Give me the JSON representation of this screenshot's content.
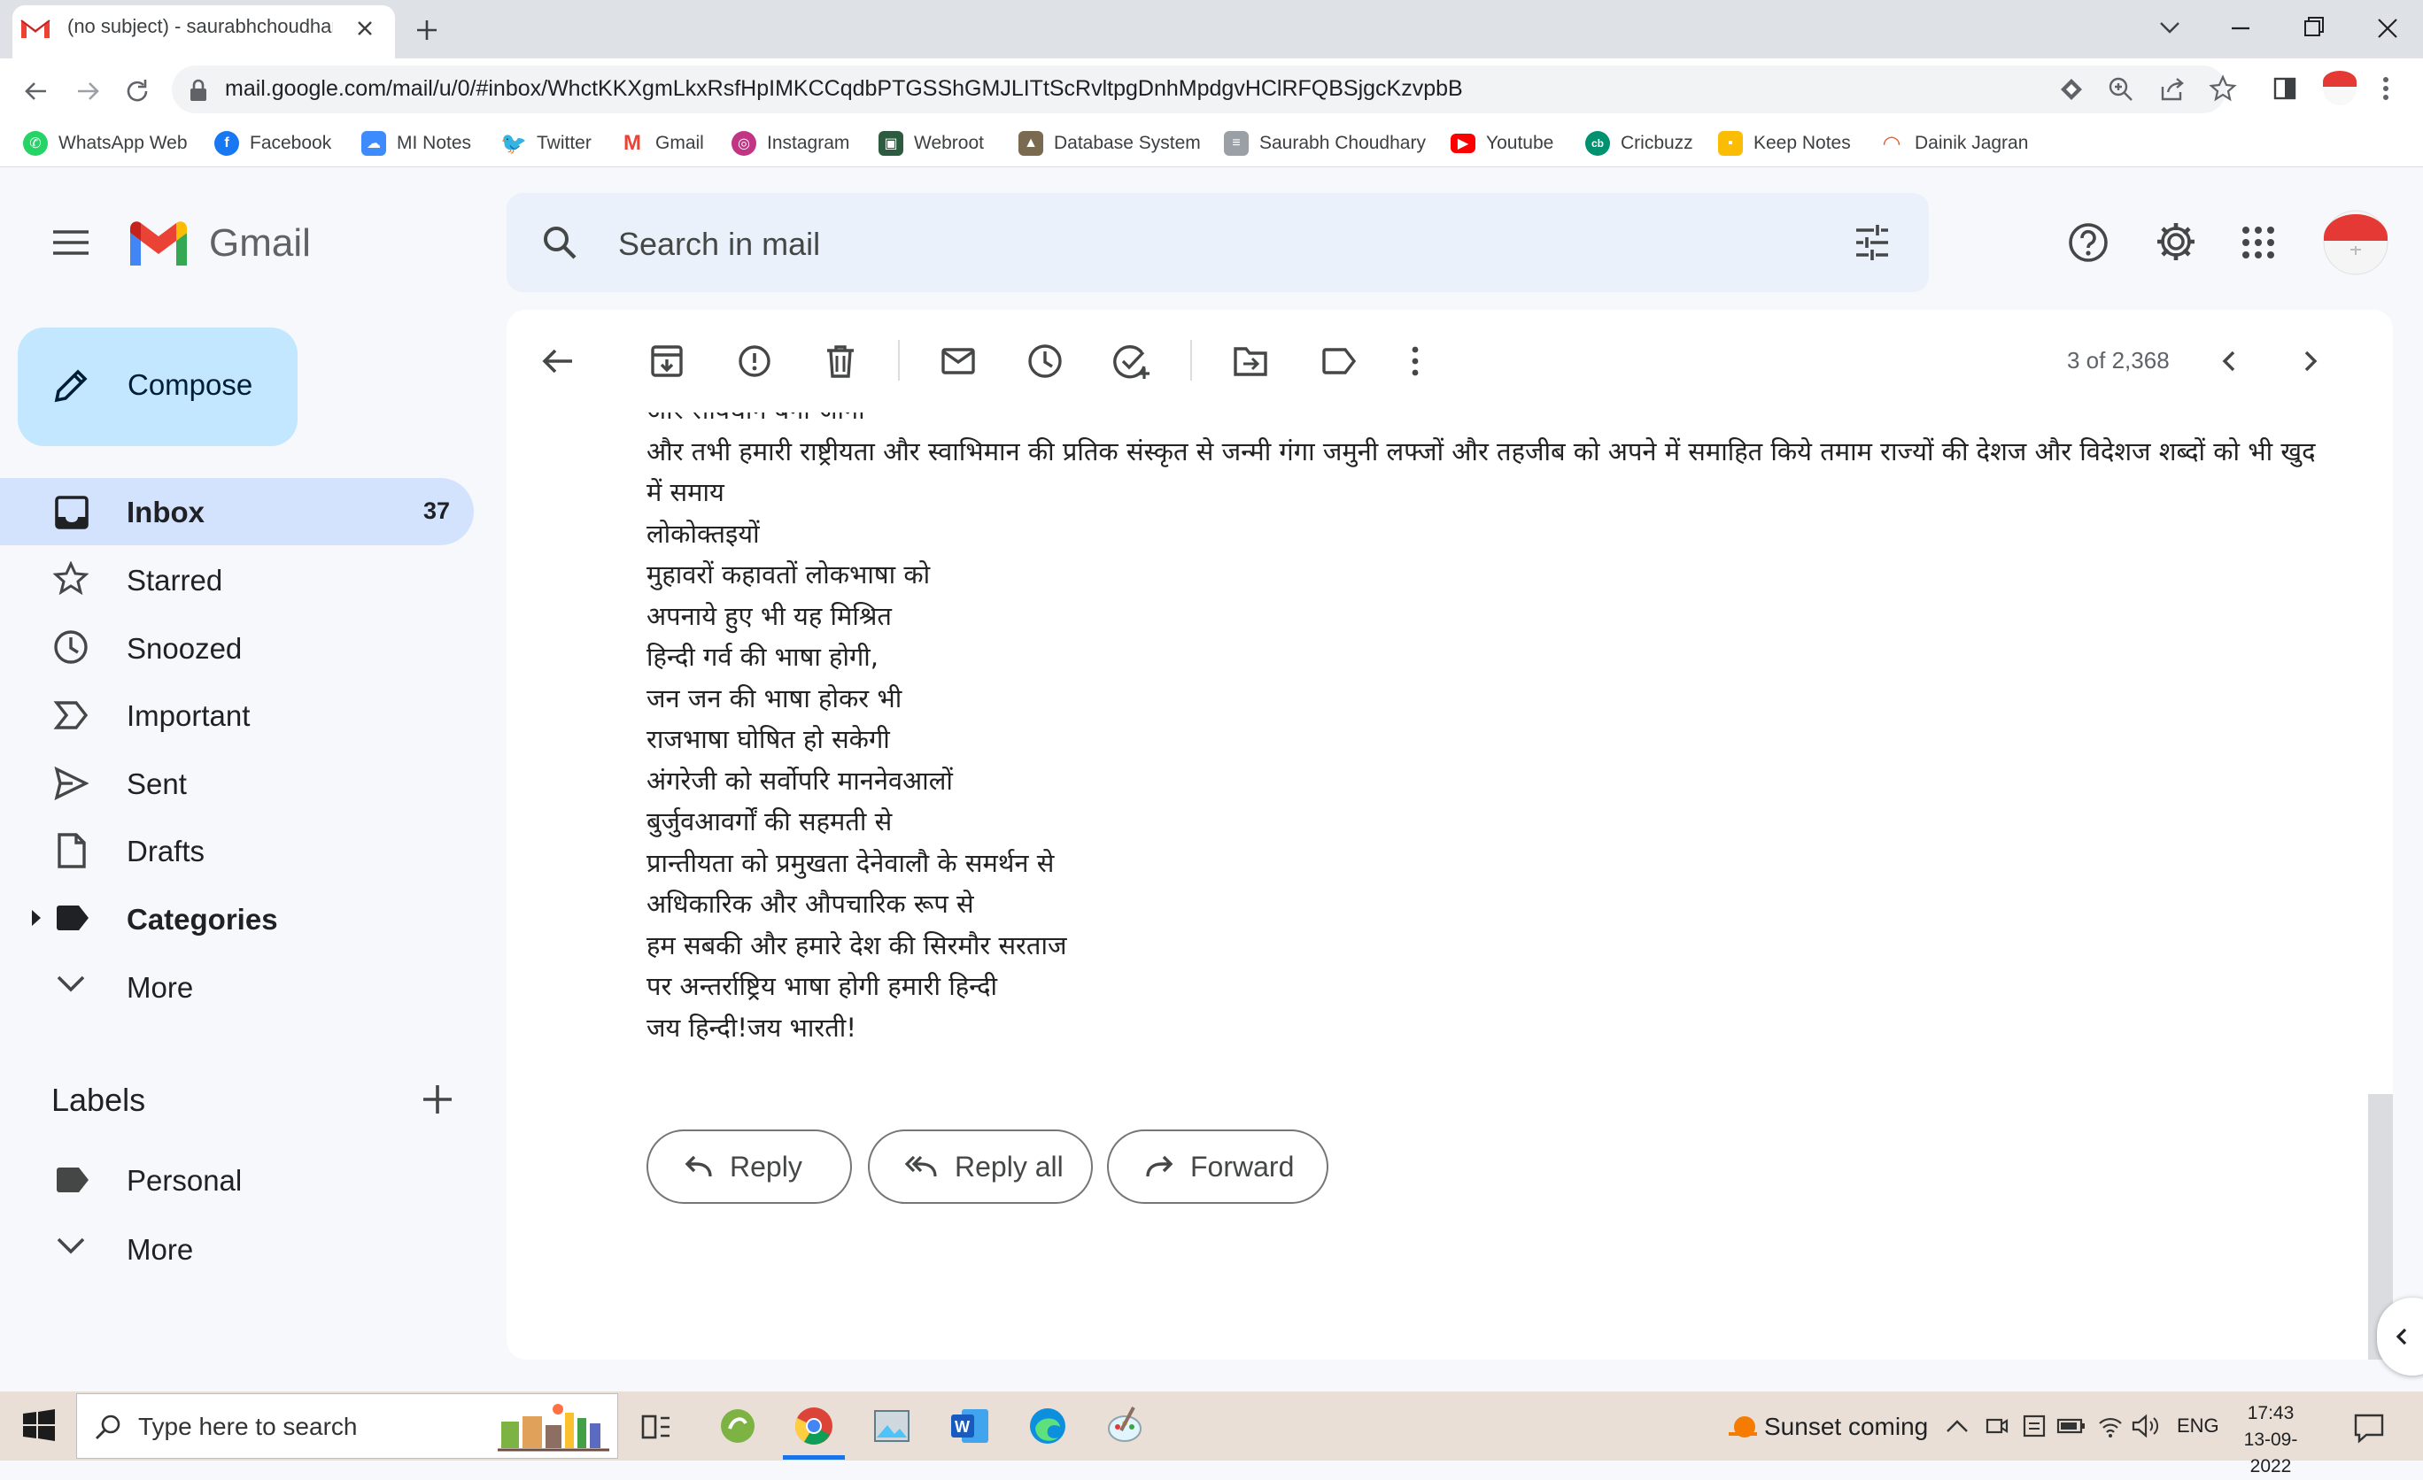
{
  "browser": {
    "tab_title": "(no subject) - saurabhchoudhary",
    "url": "mail.google.com/mail/u/0/#inbox/WhctKKXgmLkxRsfHpIMKCCqdbPTGSShGMJLITtScRvltpgDnhMpdgvHClRFQBSjgcKzvpbB",
    "bookmarks": [
      {
        "label": "WhatsApp Web",
        "color": "#25d366"
      },
      {
        "label": "Facebook",
        "color": "#1877f2"
      },
      {
        "label": "MI Notes",
        "color": "#3d8bfd"
      },
      {
        "label": "Twitter",
        "color": "#1da1f2"
      },
      {
        "label": "Gmail",
        "color": "#ea4335"
      },
      {
        "label": "Instagram",
        "color": "#c13584"
      },
      {
        "label": "Webroot",
        "color": "#2d5b3f"
      },
      {
        "label": "Database System",
        "color": "#7a6a4f"
      },
      {
        "label": "Saurabh Choudhary",
        "color": "#9aa0a6"
      },
      {
        "label": "Youtube",
        "color": "#ff0000"
      },
      {
        "label": "Cricbuzz",
        "color": "#009270"
      },
      {
        "label": "Keep Notes",
        "color": "#fbbc04"
      },
      {
        "label": "Dainik Jagran",
        "color": "#e8572a"
      }
    ]
  },
  "gmail": {
    "logo_text": "Gmail",
    "search_placeholder": "Search in mail",
    "compose_label": "Compose",
    "nav": [
      {
        "label": "Inbox",
        "count": "37"
      },
      {
        "label": "Starred"
      },
      {
        "label": "Snoozed"
      },
      {
        "label": "Important"
      },
      {
        "label": "Sent"
      },
      {
        "label": "Drafts"
      },
      {
        "label": "Categories"
      },
      {
        "label": "More"
      }
    ],
    "labels_title": "Labels",
    "labels": [
      {
        "label": "Personal"
      },
      {
        "label": "More"
      }
    ],
    "pager": "3 of 2,368",
    "message_lines": [
      "और संविधान बना जाना",
      "और तभी हमारी राष्ट्रीयता और स्वाभिमान की प्रतिक संस्कृत से जन्मी गंगा जमुनी लफ्जों और तहजीब को अपने में समाहित किये तमाम राज्यों की देशज और विदेशज शब्दों को भी खुद में समाय",
      "लोकोक्तइयों",
      "मुहावरों कहावतों लोकभाषा को",
      "अपनाये हुए भी  यह मिश्रित",
      "हिन्दी गर्व की भाषा होगी,",
      "जन जन की भाषा होकर भी",
      " राजभाषा घोषित हो सकेगी",
      "अंगरेजी को सर्वोपरि माननेवआलों",
      "बुर्जुवआवर्गों की सहमती से",
      "प्रान्तीयता को प्रमुखता देनेवालौ के समर्थन से",
      " अधिकारिक और औपचारिक रूप से",
      "हम सबकी और हमारे देश की सिरमौर सरताज",
      "पर अन्तर्राष्ट्रिय भाषा होगी हमारी हिन्दी",
      "जय हिन्दी!जय भारती!"
    ],
    "actions": {
      "reply": "Reply",
      "reply_all": "Reply all",
      "forward": "Forward"
    }
  },
  "taskbar": {
    "search_placeholder": "Type here to search",
    "weather": "Sunset coming",
    "language": "ENG",
    "time": "17:43",
    "date": "13-09-2022"
  }
}
